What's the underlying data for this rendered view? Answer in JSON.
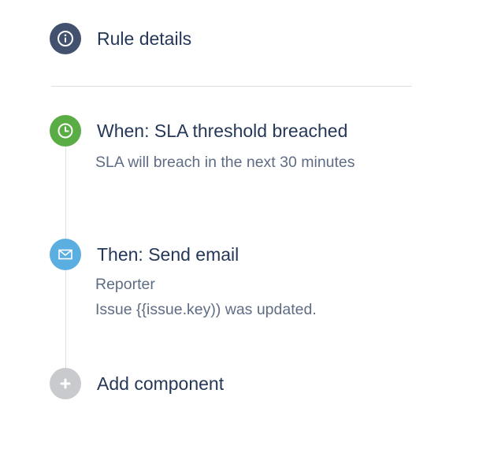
{
  "rule_details": {
    "label": "Rule details",
    "icon": "info-icon",
    "color": "#42526e"
  },
  "trigger": {
    "title": "When: SLA threshold breached",
    "description": "SLA will breach in the next 30 minutes",
    "icon": "clock-icon",
    "color": "#5aac44"
  },
  "action": {
    "title": "Then: Send email",
    "recipient": "Reporter",
    "subject": "Issue {{issue.key)) was updated.",
    "icon": "envelope-icon",
    "color": "#5aaee0"
  },
  "add_component": {
    "label": "Add component",
    "icon": "plus-icon",
    "color": "#c8cacd"
  }
}
